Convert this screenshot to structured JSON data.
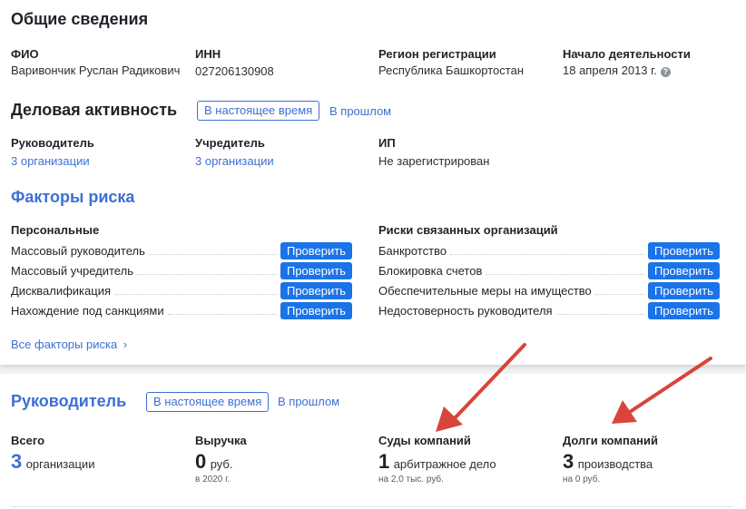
{
  "general": {
    "title": "Общие сведения",
    "fio_label": "ФИО",
    "fio_value": "Варивончик Руслан Радикович",
    "inn_label": "ИНН",
    "inn_value": "027206130908",
    "region_label": "Регион регистрации",
    "region_value": "Республика Башкортостан",
    "start_label": "Начало деятельности",
    "start_value": "18 апреля 2013 г.",
    "help_icon": "?"
  },
  "business": {
    "title": "Деловая активность",
    "tab_current": "В настоящее время",
    "tab_past": "В прошлом",
    "head_label": "Руководитель",
    "head_value": "3 организации",
    "founder_label": "Учредитель",
    "founder_value": "3 организации",
    "ip_label": "ИП",
    "ip_value": "Не зарегистрирован"
  },
  "risks": {
    "title": "Факторы риска",
    "personal_title": "Персональные",
    "related_title": "Риски связанных организаций",
    "check_label": "Проверить",
    "personal": [
      "Массовый руководитель",
      "Массовый учредитель",
      "Дисквалификация",
      "Нахождение под санкциями"
    ],
    "related": [
      "Банкротство",
      "Блокировка счетов",
      "Обеспечительные меры на имущество",
      "Недостоверность руководителя"
    ],
    "all_link": "Все факторы риска",
    "chevron": "›"
  },
  "director": {
    "title": "Руководитель",
    "tab_current": "В настоящее время",
    "tab_past": "В прошлом",
    "total_label": "Всего",
    "total_num": "3",
    "total_unit": "организации",
    "revenue_label": "Выручка",
    "revenue_num": "0",
    "revenue_unit": "руб.",
    "revenue_note": "в 2020 г.",
    "courts_label": "Суды компаний",
    "courts_num": "1",
    "courts_unit": "арбитражное дело",
    "courts_note": "на 2,0 тыс. руб.",
    "debts_label": "Долги компаний",
    "debts_num": "3",
    "debts_unit": "производства",
    "debts_note": "на 0 руб."
  },
  "annotation": {
    "arrow_color": "#d9453a"
  }
}
